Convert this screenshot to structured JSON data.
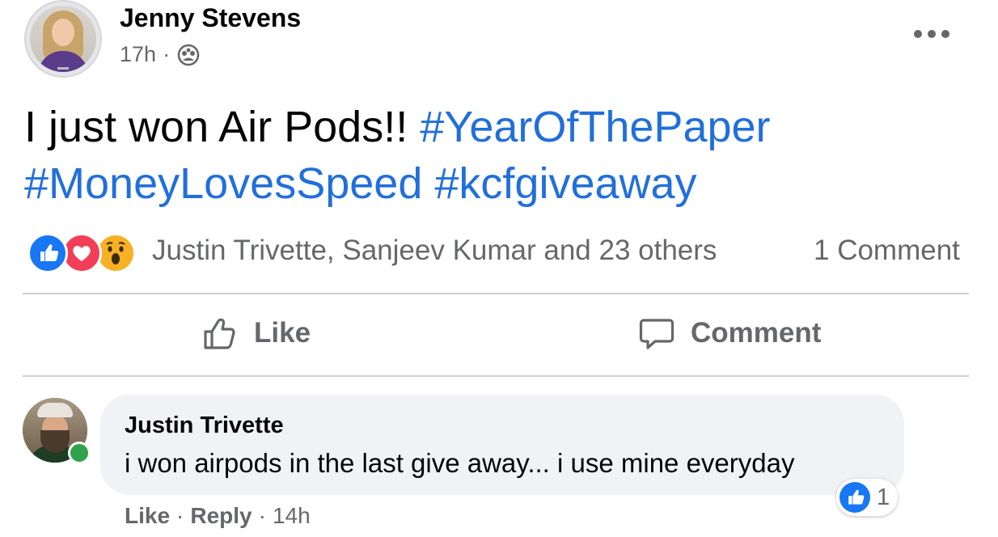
{
  "post": {
    "author": "Jenny Stevens",
    "time": "17h",
    "separator": "·",
    "text_plain": "I just won Air Pods!!",
    "hashtags": [
      "#YearOfThePaper",
      "#MoneyLovesSpeed",
      "#kcfgiveaway"
    ]
  },
  "reactions": {
    "icons": [
      "like-icon",
      "love-icon",
      "wow-icon"
    ],
    "summary": "Justin Trivette, Sanjeev Kumar and 23 others",
    "comments_count": "1 Comment"
  },
  "actions": {
    "like_label": "Like",
    "comment_label": "Comment"
  },
  "comment": {
    "author": "Justin Trivette",
    "text": "i won airpods in the last give away... i use mine everyday",
    "reaction_count": "1",
    "like_label": "Like",
    "reply_label": "Reply",
    "time": "14h",
    "separator": "·"
  },
  "colors": {
    "hashtag": "#216fdb",
    "like_blue": "#1877f2",
    "love_red": "#f33e58",
    "wow_yellow": "#f7b125",
    "online_green": "#31a24c",
    "secondary_text": "#65676b"
  }
}
